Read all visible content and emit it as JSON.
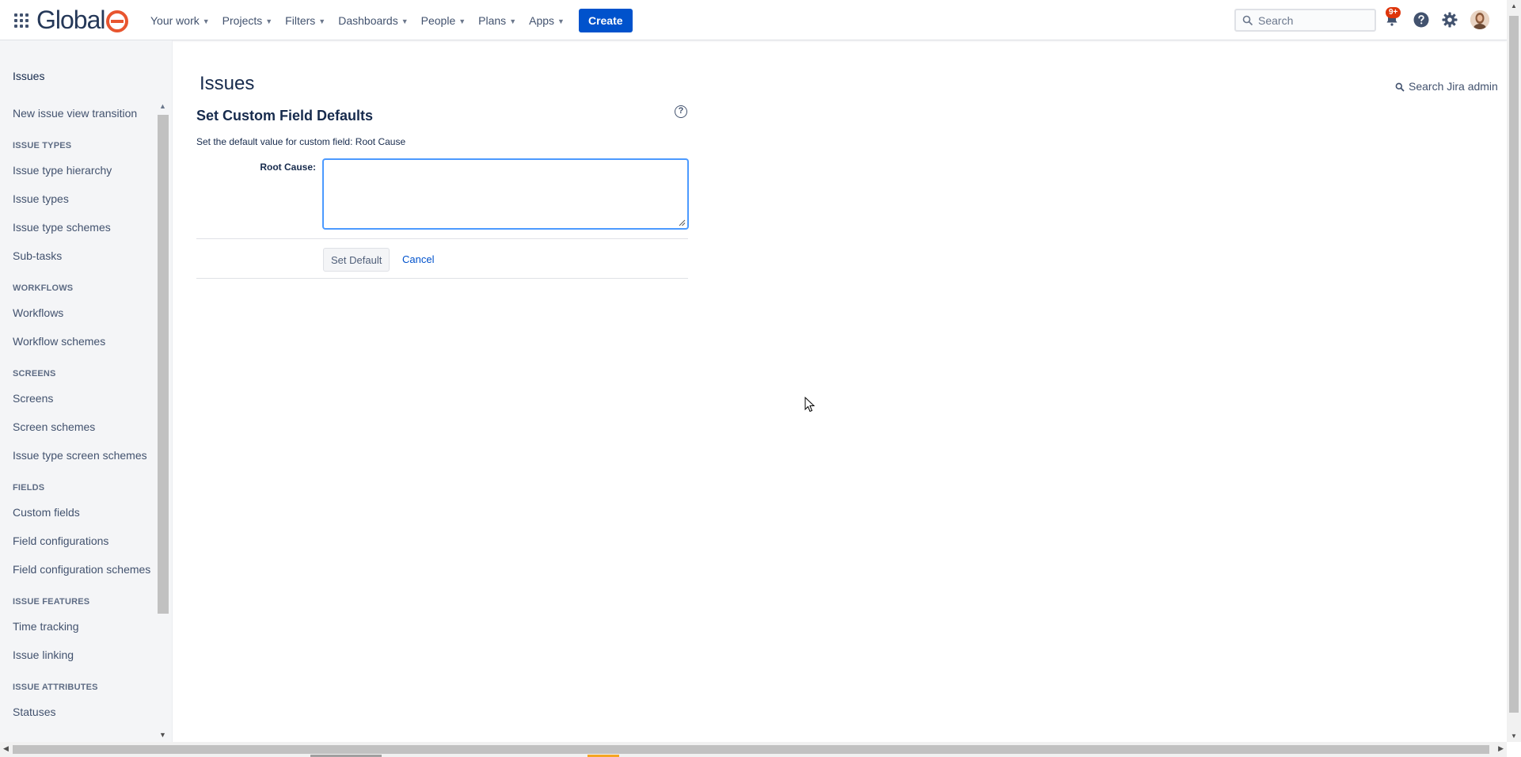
{
  "topnav": {
    "logo_text": "Global",
    "nav_items": [
      {
        "label": "Your work"
      },
      {
        "label": "Projects"
      },
      {
        "label": "Filters"
      },
      {
        "label": "Dashboards"
      },
      {
        "label": "People"
      },
      {
        "label": "Plans"
      },
      {
        "label": "Apps"
      }
    ],
    "create_label": "Create",
    "search_placeholder": "Search",
    "notification_badge": "9+",
    "icons": [
      "app-switcher-icon",
      "notifications-icon",
      "help-icon",
      "settings-icon"
    ]
  },
  "sidebar": {
    "title": "Issues",
    "top_item": "New issue view transition",
    "sections": [
      {
        "heading": "ISSUE TYPES",
        "items": [
          "Issue type hierarchy",
          "Issue types",
          "Issue type schemes",
          "Sub-tasks"
        ]
      },
      {
        "heading": "WORKFLOWS",
        "items": [
          "Workflows",
          "Workflow schemes"
        ]
      },
      {
        "heading": "SCREENS",
        "items": [
          "Screens",
          "Screen schemes",
          "Issue type screen schemes"
        ]
      },
      {
        "heading": "FIELDS",
        "items": [
          "Custom fields",
          "Field configurations",
          "Field configuration schemes"
        ]
      },
      {
        "heading": "ISSUE FEATURES",
        "items": [
          "Time tracking",
          "Issue linking"
        ]
      },
      {
        "heading": "ISSUE ATTRIBUTES",
        "items": [
          "Statuses"
        ]
      }
    ]
  },
  "main": {
    "page_title": "Issues",
    "admin_search": "Search Jira admin",
    "section_title": "Set Custom Field Defaults",
    "description": "Set the default value for custom field: Root Cause",
    "field_label": "Root Cause:",
    "field_value": "",
    "set_default_label": "Set Default",
    "cancel_label": "Cancel"
  },
  "colors": {
    "primary": "#0052cc",
    "logo_accent": "#e8552f",
    "badge": "#de350b",
    "focus": "#4c9aff"
  }
}
